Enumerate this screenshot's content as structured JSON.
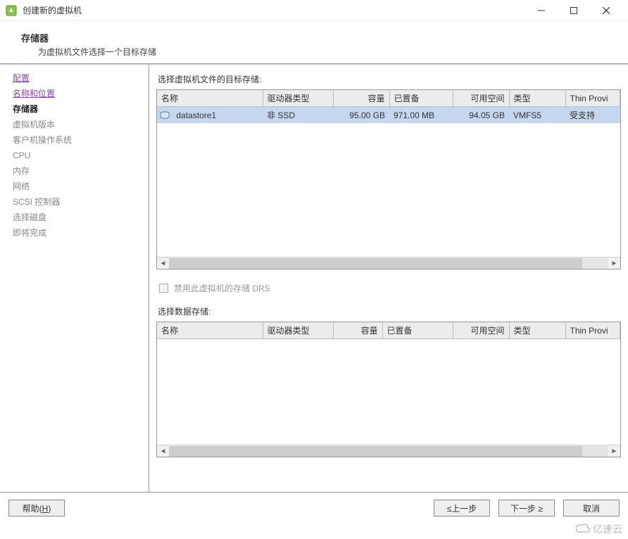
{
  "window": {
    "title": "创建新的虚拟机"
  },
  "header": {
    "title": "存储器",
    "subtitle": "为虚拟机文件选择一个目标存储"
  },
  "sidebar": {
    "steps": [
      {
        "label": "配置",
        "state": "visited"
      },
      {
        "label": "名称和位置",
        "state": "visited"
      },
      {
        "label": "存储器",
        "state": "current"
      },
      {
        "label": "虚拟机版本",
        "state": "pending"
      },
      {
        "label": "客户机操作系统",
        "state": "pending"
      },
      {
        "label": "CPU",
        "state": "pending"
      },
      {
        "label": "内存",
        "state": "pending"
      },
      {
        "label": "网络",
        "state": "pending"
      },
      {
        "label": "SCSI 控制器",
        "state": "pending"
      },
      {
        "label": "选择磁盘",
        "state": "pending"
      },
      {
        "label": "即将完成",
        "state": "pending"
      }
    ]
  },
  "main": {
    "select_label": "选择虚拟机文件的目标存储:",
    "columns": {
      "name": "名称",
      "drive_type": "驱动器类型",
      "capacity": "容量",
      "provisioned": "已置备",
      "free": "可用空间",
      "type": "类型",
      "thin": "Thin Provi"
    },
    "rows": [
      {
        "name": "datastore1",
        "drive_type": "非 SSD",
        "capacity": "95.00 GB",
        "provisioned": "971.00 MB",
        "free": "94.05 GB",
        "type": "VMFS5",
        "thin": "受支持"
      }
    ],
    "drs_checkbox": "禁用此虚拟机的存储 DRS",
    "select_datastore_label": "选择数据存储:"
  },
  "buttons": {
    "help": "帮助(H)",
    "back_prefix": "≤上一步",
    "next_prefix": "下一步",
    "next_suffix": " ≥",
    "cancel": "取消"
  },
  "watermark": "亿速云"
}
